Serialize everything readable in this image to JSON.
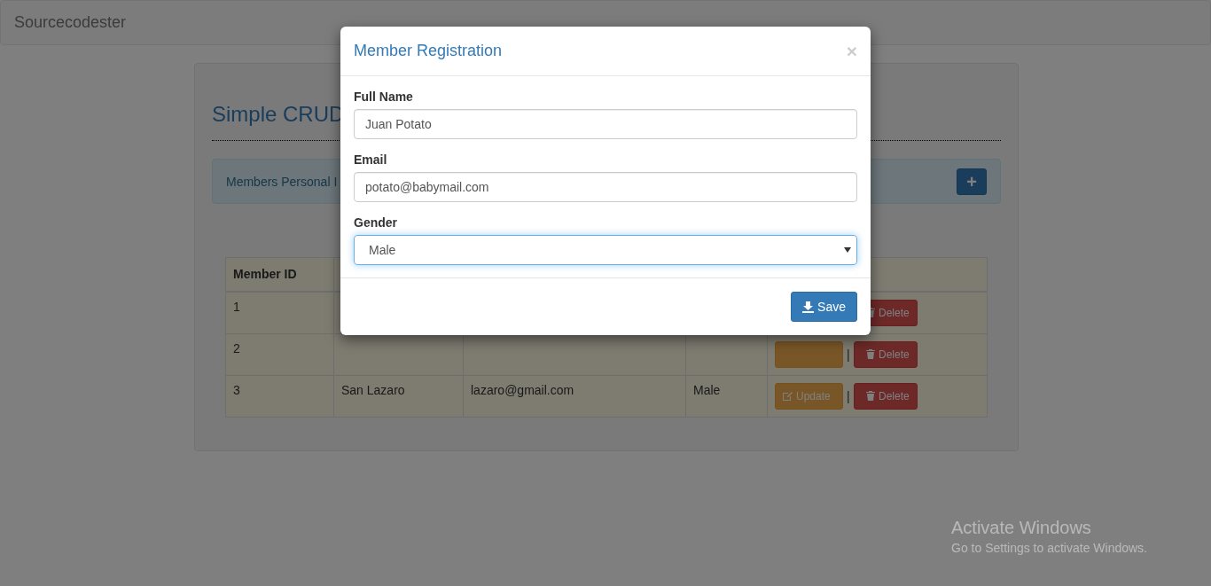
{
  "navbar": {
    "brand": "Sourcecodester"
  },
  "page": {
    "heading": "Simple CRUD",
    "panel_text": "Members Personal I",
    "add_button": "+"
  },
  "table": {
    "columns": [
      "Member ID"
    ],
    "rows": [
      {
        "cells": [
          "1"
        ],
        "update": null,
        "separator": "",
        "delete": "Delete"
      },
      {
        "cells": [
          "2"
        ],
        "update": "",
        "separator": "|",
        "delete": "Delete"
      },
      {
        "cells": [
          "3",
          "San Lazaro",
          "lazaro@gmail.com",
          "Male"
        ],
        "update": "Update",
        "separator": "|",
        "delete": "Delete"
      }
    ]
  },
  "modal": {
    "title": "Member Registration",
    "close": "×",
    "fields": [
      {
        "kind": "text",
        "label": "Full Name",
        "value": "Juan Potato",
        "focused": false
      },
      {
        "kind": "text",
        "label": "Email",
        "value": "potato@babymail.com",
        "focused": false
      },
      {
        "kind": "select",
        "label": "Gender",
        "value": "Male",
        "focused": true
      }
    ],
    "save_button": "Save"
  },
  "os_notice": {
    "title": "Activate Windows",
    "subtitle": "Go to Settings to activate Windows."
  }
}
